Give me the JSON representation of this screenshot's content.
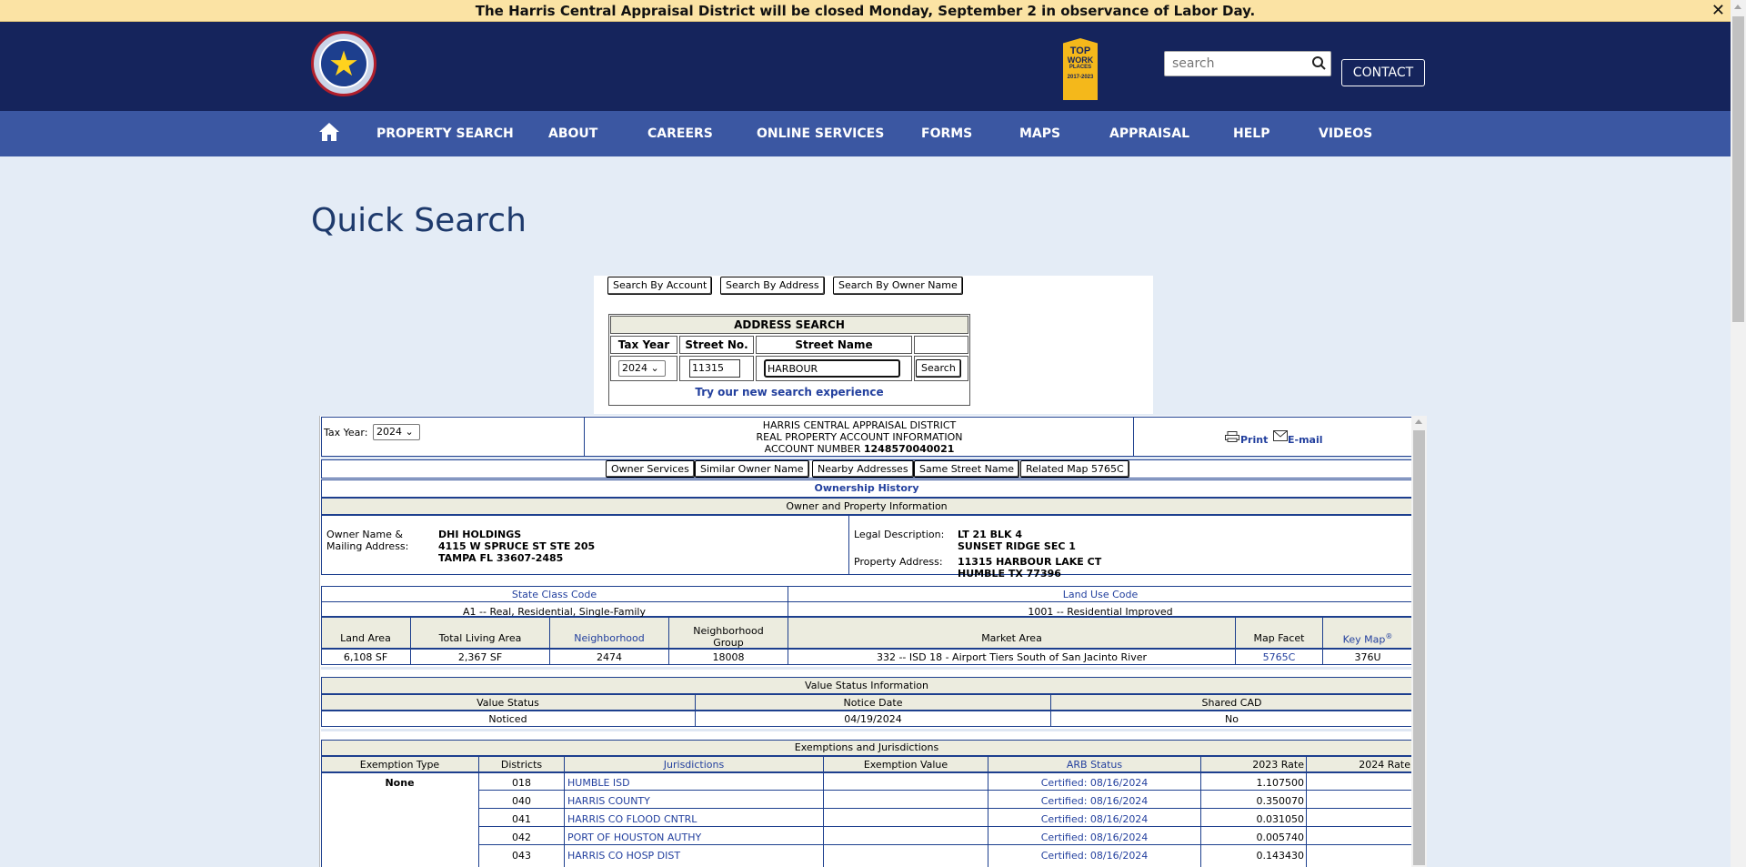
{
  "banner": {
    "text": "The Harris Central Appraisal District will be closed Monday, September 2 in observance of Labor Day.",
    "close_glyph": "✕"
  },
  "header": {
    "search_placeholder": "search",
    "contact_label": "CONTACT",
    "badge": {
      "line1": "TOP",
      "line2": "WORK",
      "line3": "PLACES",
      "line4": "2017-2023"
    },
    "logo_star": "★"
  },
  "nav": {
    "items": [
      "PROPERTY SEARCH",
      "ABOUT",
      "CAREERS",
      "ONLINE SERVICES",
      "FORMS",
      "MAPS",
      "APPRAISAL",
      "HELP",
      "VIDEOS"
    ]
  },
  "page": {
    "title": "Quick Search"
  },
  "quick_search": {
    "buttons": [
      "Search By Account",
      "Search By Address",
      "Search By Owner Name"
    ],
    "address_search": {
      "title": "ADDRESS SEARCH",
      "col_tax_year": "Tax Year",
      "col_street_no": "Street No.",
      "col_street_name": "Street Name",
      "tax_year": "2024",
      "street_no": "11315",
      "street_name": "HARBOUR",
      "search_label": "Search",
      "new_experience": "Try our new search experience"
    }
  },
  "report": {
    "tax_year_label": "Tax Year:",
    "tax_year": "2024",
    "district": "HARRIS CENTRAL APPRAISAL DISTRICT",
    "subtitle": "REAL PROPERTY ACCOUNT INFORMATION",
    "account_label": "ACCOUNT NUMBER",
    "account_number": "1248570040021",
    "print_label": "Print",
    "email_label": "E-mail",
    "action_buttons": [
      "Owner Services",
      "Similar Owner Name",
      "Nearby Addresses",
      "Same Street Name",
      "Related Map 5765C"
    ],
    "ownership_history": "Ownership History",
    "owner_section": {
      "header": "Owner and Property Information",
      "owner_label_1": "Owner Name &",
      "owner_label_2": "Mailing Address:",
      "owner_name": "DHI HOLDINGS",
      "address_1": "4115 W SPRUCE ST STE 205",
      "address_2": "TAMPA FL 33607-2485",
      "legal_label": "Legal Description:",
      "legal_1": "LT 21 BLK 4",
      "legal_2": "SUNSET RIDGE SEC 1",
      "prop_addr_label": "Property Address:",
      "prop_addr_1": "11315 HARBOUR LAKE CT",
      "prop_addr_2": "HUMBLE TX 77396"
    },
    "class": {
      "state_class_label": "State Class Code",
      "land_use_label": "Land Use Code",
      "state_class": "A1 -- Real, Residential, Single-Family",
      "land_use": "1001 -- Residential Improved"
    },
    "land": {
      "headers": [
        "Land Area",
        "Total Living Area",
        "Neighborhood",
        "Neighborhood",
        "Group",
        "Market Area",
        "Map Facet",
        "Key Map",
        "®"
      ],
      "values": [
        "6,108 SF",
        "2,367 SF",
        "2474",
        "18008",
        "332 -- ISD 18 - Airport Tiers South of San Jacinto River",
        "5765C",
        "376U"
      ]
    },
    "value_status": {
      "header": "Value Status Information",
      "cols": [
        "Value Status",
        "Notice Date",
        "Shared CAD"
      ],
      "vals": [
        "Noticed",
        "04/19/2024",
        "No"
      ]
    },
    "exemptions": {
      "header": "Exemptions and Jurisdictions",
      "cols": [
        "Exemption Type",
        "Districts",
        "Jurisdictions",
        "Exemption Value",
        "ARB Status",
        "2023 Rate",
        "2024 Rate"
      ],
      "type": "None",
      "rows": [
        {
          "district": "018",
          "name": "HUMBLE ISD",
          "arb": "Certified: 08/16/2024",
          "rate2023": "1.107500"
        },
        {
          "district": "040",
          "name": "HARRIS COUNTY",
          "arb": "Certified: 08/16/2024",
          "rate2023": "0.350070"
        },
        {
          "district": "041",
          "name": "HARRIS CO FLOOD CNTRL",
          "arb": "Certified: 08/16/2024",
          "rate2023": "0.031050"
        },
        {
          "district": "042",
          "name": "PORT OF HOUSTON AUTHY",
          "arb": "Certified: 08/16/2024",
          "rate2023": "0.005740"
        },
        {
          "district": "043",
          "name": "HARRIS CO HOSP DIST",
          "arb": "Certified: 08/16/2024",
          "rate2023": "0.143430"
        }
      ]
    }
  }
}
